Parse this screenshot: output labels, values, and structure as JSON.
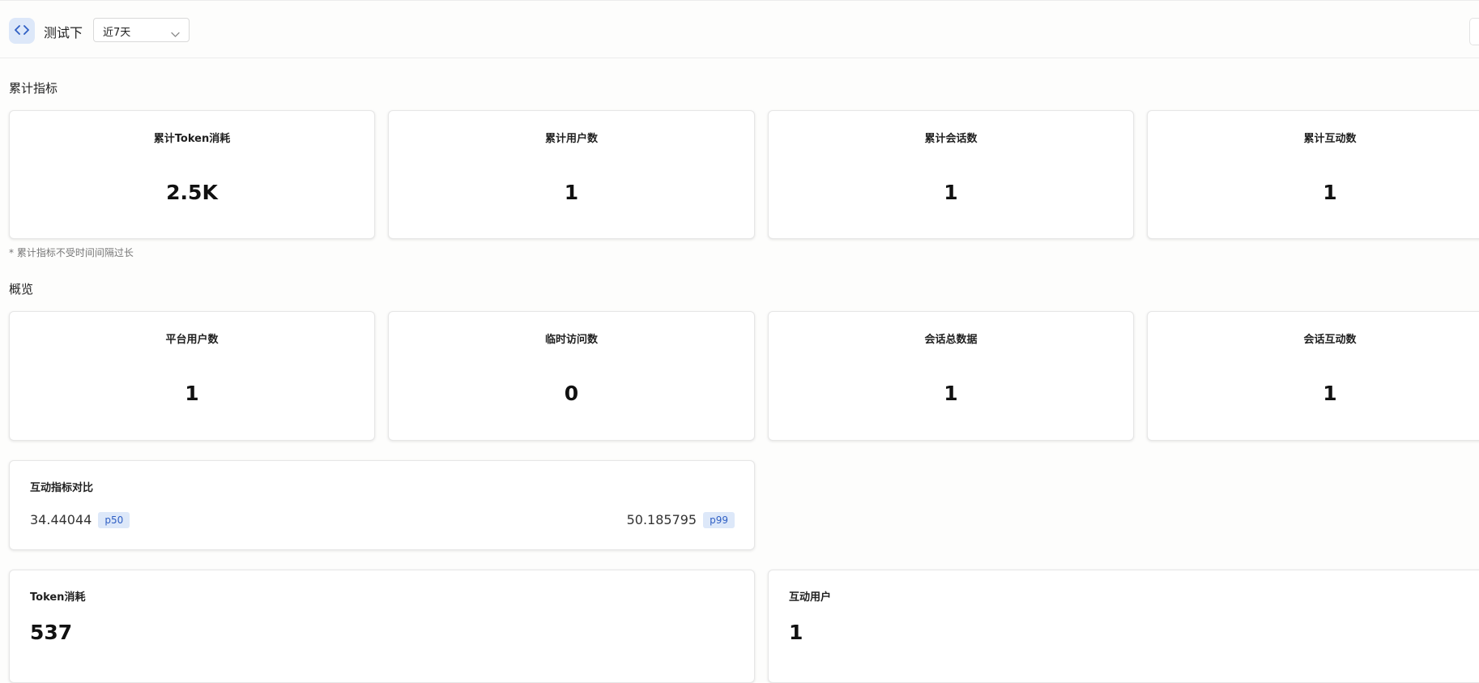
{
  "header": {
    "app_name": "测试下",
    "period_select": {
      "value": "近7天"
    },
    "icons": {
      "code": "code-brackets-icon",
      "dropdown": "chevron-down-icon"
    }
  },
  "cumulative": {
    "title": "累计指标",
    "cards": [
      {
        "label": "累计Token消耗",
        "value": "2.5K"
      },
      {
        "label": "累计用户数",
        "value": "1"
      },
      {
        "label": "累计会话数",
        "value": "1"
      },
      {
        "label": "累计互动数",
        "value": "1"
      }
    ],
    "note": "* 累计指标不受时间间隔过长"
  },
  "overview": {
    "title": "概览",
    "cards": [
      {
        "label": "平台用户数",
        "value": "1"
      },
      {
        "label": "临时访问数",
        "value": "0"
      },
      {
        "label": "会话总数据",
        "value": "1"
      },
      {
        "label": "会话互动数",
        "value": "1"
      }
    ]
  },
  "comparison": {
    "title": "互动指标对比",
    "p50": {
      "value": "34.44044",
      "tag": "p50"
    },
    "p99": {
      "value": "50.185795",
      "tag": "p99"
    }
  },
  "token_panel": {
    "title": "Token消耗",
    "value": "537"
  },
  "interact_user_panel": {
    "title": "互动用户",
    "value": "1"
  },
  "colors": {
    "accent_bg": "#dde8f9",
    "accent_text": "#2f5fc4",
    "page_bg": "#fdfdfc"
  }
}
